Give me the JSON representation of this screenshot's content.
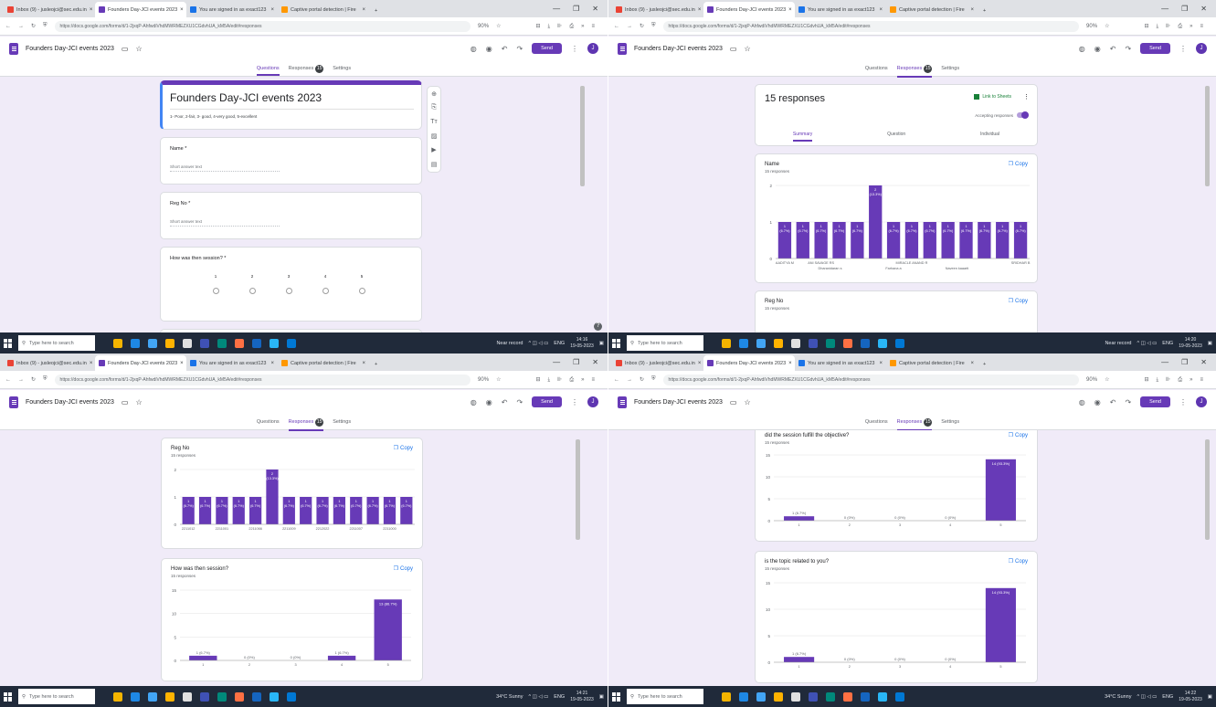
{
  "browser": {
    "tabs_left": [
      "Inbox (9) - jusleojci@sec.edu.in",
      "Founders Day-JCI events 2023",
      "You are signed in as exact123",
      "Captive portal detection | Fire"
    ],
    "tabs_right": [
      "Inbox (9) - jusleojci@sec.edu.in",
      "Founders Day-JCI events 2023",
      "You are signed in as exact123",
      "Captive portal detection | Fire"
    ],
    "new_tab": "+",
    "url": "https://docs.google.com/forms/d/1-2jxqP-AhfwdiVhdMWRMEZXU1CGdvhUA_kM5A/edit#responses",
    "zoom": "90%"
  },
  "form": {
    "doc_title": "Founders Day-JCI events 2023",
    "send_label": "Send",
    "avatar_letter": "J",
    "tabs": [
      "Questions",
      "Responses",
      "Settings"
    ],
    "responses_count": "15",
    "title": "Founders Day-JCI events 2023",
    "description": "1- Poor, 2-fair, 3- good, 4-very good, 5-excellent",
    "q_name": "Name *",
    "q_regno": "Reg No *",
    "q_session": "How was then session? *",
    "short_answer": "Short answer text",
    "scale": [
      "1",
      "2",
      "3",
      "4",
      "5"
    ]
  },
  "responses": {
    "count_label": "15 responses",
    "sheets_label": "Link to Sheets",
    "accepting_label": "Accepting responses",
    "subtabs": [
      "Summary",
      "Question",
      "Individual"
    ],
    "copy_label": "Copy",
    "n_responses": "15 responses"
  },
  "taskbar": {
    "search_placeholder": "Type here to search",
    "tray_q0": {
      "weather": "Near record",
      "lang": "ENG",
      "time": "14:16",
      "date": "19-05-2023"
    },
    "tray_q1": {
      "weather": "Near record",
      "lang": "ENG",
      "time": "14:20",
      "date": "19-05-2023"
    },
    "tray_q2": {
      "weather": "34°C Sunny",
      "lang": "ENG",
      "time": "14:21",
      "date": "19-05-2023"
    },
    "tray_q3": {
      "weather": "34°C Sunny",
      "lang": "ENG",
      "time": "14:22",
      "date": "19-05-2023"
    }
  },
  "chart_data": [
    {
      "type": "bar",
      "title": "Name",
      "subtitle": "15 responses",
      "categories": [
        "AADITYA M",
        "",
        "ANI SAVAGE RS",
        "",
        "",
        "",
        "",
        "MIRACLE ANAND R",
        "",
        "",
        "",
        "",
        "",
        "SRIDHAR B"
      ],
      "values": [
        1,
        1,
        1,
        1,
        1,
        2,
        1,
        1,
        1,
        1,
        1,
        1,
        1,
        1
      ],
      "bar_labels": [
        "1 (6.7%)",
        "1 (6.7%)",
        "1 (6.7%)",
        "1 (6.7%)",
        "1 (6.7%)",
        "2 (13.3%)",
        "1 (6.7%)",
        "1 (6.7%)",
        "1 (6.7%)",
        "1 (6.7%)",
        "1 (6.7%)",
        "1 (6.7%)",
        "1 (6.7%)",
        "1 (6.7%)"
      ],
      "second_row_labels": [
        "Dharanidaran s",
        "Farhana a",
        "Naveen kaaarti"
      ],
      "ylim": [
        0,
        2
      ],
      "yticks": [
        "0",
        "1",
        "2"
      ]
    },
    {
      "type": "bar",
      "title": "Reg No",
      "subtitle": "15 responses",
      "categories": [
        "2211012",
        "",
        "2211001",
        "",
        "2211066",
        "",
        "2211009",
        "",
        "2212022",
        "",
        "2211007",
        "",
        "2211000",
        ""
      ],
      "values": [
        1,
        1,
        1,
        1,
        1,
        2,
        1,
        1,
        1,
        1,
        1,
        1,
        1,
        1
      ],
      "bar_labels": [
        "1 (6.7%)",
        "1 (6.7%)",
        "1 (6.7%)",
        "1 (6.7%)",
        "1 (6.7%)",
        "2 (13.3%)",
        "1 (6.7%)",
        "1 (6.7%)",
        "1 (6.7%)",
        "1 (6.7%)",
        "1 (6.7%)",
        "1 (6.7%)",
        "1 (6.7%)",
        "1 (6.7%)"
      ],
      "ylim": [
        0,
        2
      ],
      "yticks": [
        "0",
        "1",
        "2"
      ]
    },
    {
      "type": "bar",
      "title": "How was then session?",
      "subtitle": "15 responses",
      "categories": [
        "1",
        "2",
        "3",
        "4",
        "5"
      ],
      "values": [
        1,
        0,
        0,
        1,
        13
      ],
      "bar_labels": [
        "1 (6.7%)",
        "0 (0%)",
        "0 (0%)",
        "1 (6.7%)",
        "13 (86.7%)"
      ],
      "ylim": [
        0,
        15
      ],
      "yticks": [
        "0",
        "5",
        "10",
        "15"
      ]
    },
    {
      "type": "bar",
      "title": "did the session fulfill the objective?",
      "subtitle": "15 responses",
      "categories": [
        "1",
        "2",
        "3",
        "4",
        "5"
      ],
      "values": [
        1,
        0,
        0,
        0,
        14
      ],
      "bar_labels": [
        "1 (6.7%)",
        "0 (0%)",
        "0 (0%)",
        "0 (0%)",
        "14 (93.3%)"
      ],
      "ylim": [
        0,
        15
      ],
      "yticks": [
        "0",
        "5",
        "10",
        "15"
      ]
    },
    {
      "type": "bar",
      "title": "is the topic related to you?",
      "subtitle": "15 responses",
      "categories": [
        "1",
        "2",
        "3",
        "4",
        "5"
      ],
      "values": [
        1,
        0,
        0,
        0,
        14
      ],
      "bar_labels": [
        "1 (6.7%)",
        "0 (0%)",
        "0 (0%)",
        "0 (0%)",
        "14 (93.3%)"
      ],
      "ylim": [
        0,
        15
      ],
      "yticks": [
        "0",
        "5",
        "10",
        "15"
      ]
    }
  ],
  "colors": {
    "accent": "#673ab7",
    "bar": "#673ab7",
    "background": "#f0ebf8",
    "taskbar": "#202a3a"
  }
}
